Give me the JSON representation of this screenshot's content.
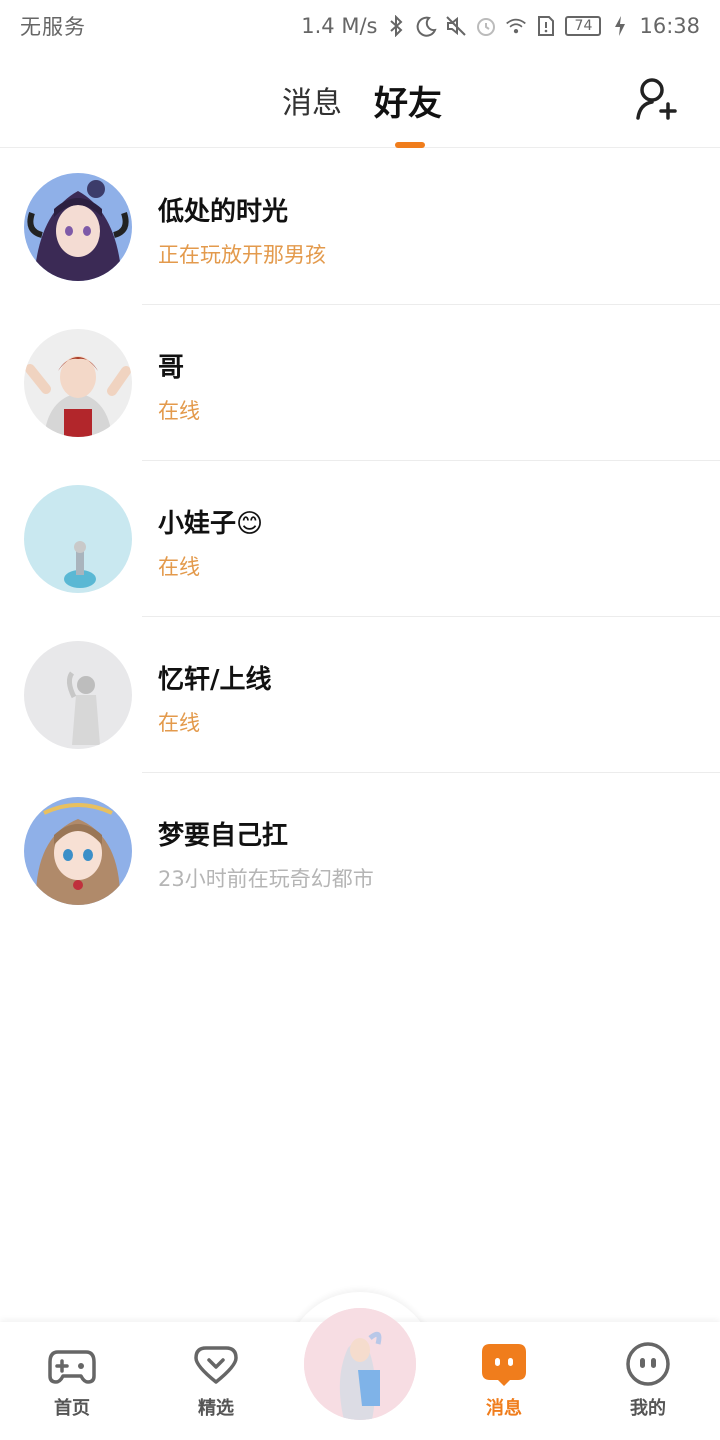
{
  "status_bar": {
    "carrier": "无服务",
    "speed": "1.4 M/s",
    "battery": "74",
    "time": "16:38"
  },
  "header": {
    "tabs": [
      {
        "label": "消息",
        "active": false
      },
      {
        "label": "好友",
        "active": true
      }
    ],
    "add_friend_icon": "add-user-icon",
    "accent": "#f07d1c"
  },
  "friends": [
    {
      "name": "低处的时光",
      "status": "正在玩放开那男孩",
      "status_color": "#e39a4c"
    },
    {
      "name": "哥",
      "status": "在线",
      "status_color": "#e39a4c"
    },
    {
      "name": "小娃子😊",
      "status": "在线",
      "status_color": "#e39a4c"
    },
    {
      "name": "忆轩/上线",
      "status": "在线",
      "status_color": "#e39a4c"
    },
    {
      "name": "梦要自己扛",
      "status": "23小时前在玩奇幻都市",
      "status_color": "#b5b5b5"
    }
  ],
  "bottom_nav": {
    "items": [
      {
        "label": "首页",
        "icon": "gamepad-icon",
        "active": false
      },
      {
        "label": "精选",
        "icon": "heart-chat-icon",
        "active": false
      },
      {
        "label": "",
        "icon": "avatar",
        "active": false
      },
      {
        "label": "消息",
        "icon": "message-icon",
        "active": true
      },
      {
        "label": "我的",
        "icon": "face-icon",
        "active": false
      }
    ]
  }
}
